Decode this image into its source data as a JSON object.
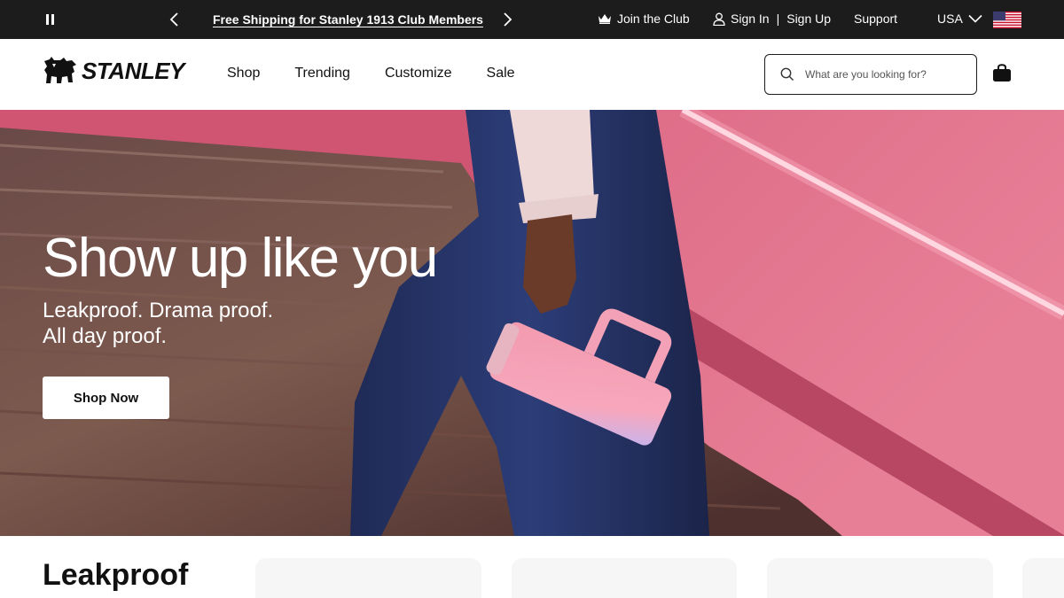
{
  "promo": {
    "message": "Free Shipping for Stanley 1913 Club Members"
  },
  "utility": {
    "join_club": "Join the Club",
    "sign_in": "Sign In",
    "separator": "|",
    "sign_up": "Sign Up",
    "support": "Support",
    "country": "USA"
  },
  "header": {
    "logo_text": "STANLEY",
    "nav": [
      "Shop",
      "Trending",
      "Customize",
      "Sale"
    ],
    "search_placeholder": "What are you looking for?"
  },
  "hero": {
    "title": "Show up like you",
    "subtitle_line1": "Leakproof. Drama proof.",
    "subtitle_line2": "All day proof.",
    "cta": "Shop Now"
  },
  "section": {
    "title": "Leakproof"
  },
  "icons": {
    "pause": "pause-icon",
    "prev": "chevron-left-icon",
    "next": "chevron-right-icon",
    "club": "crown-icon",
    "user": "user-icon",
    "country_dropdown": "chevron-down-icon",
    "flag": "us-flag-icon",
    "search": "search-icon",
    "bag": "shopping-bag-icon",
    "logo": "bear-logo-icon"
  },
  "colors": {
    "promo_bg": "#1c1c1c",
    "hero_pink": "#e0607e",
    "cta_bg": "#ffffff"
  }
}
